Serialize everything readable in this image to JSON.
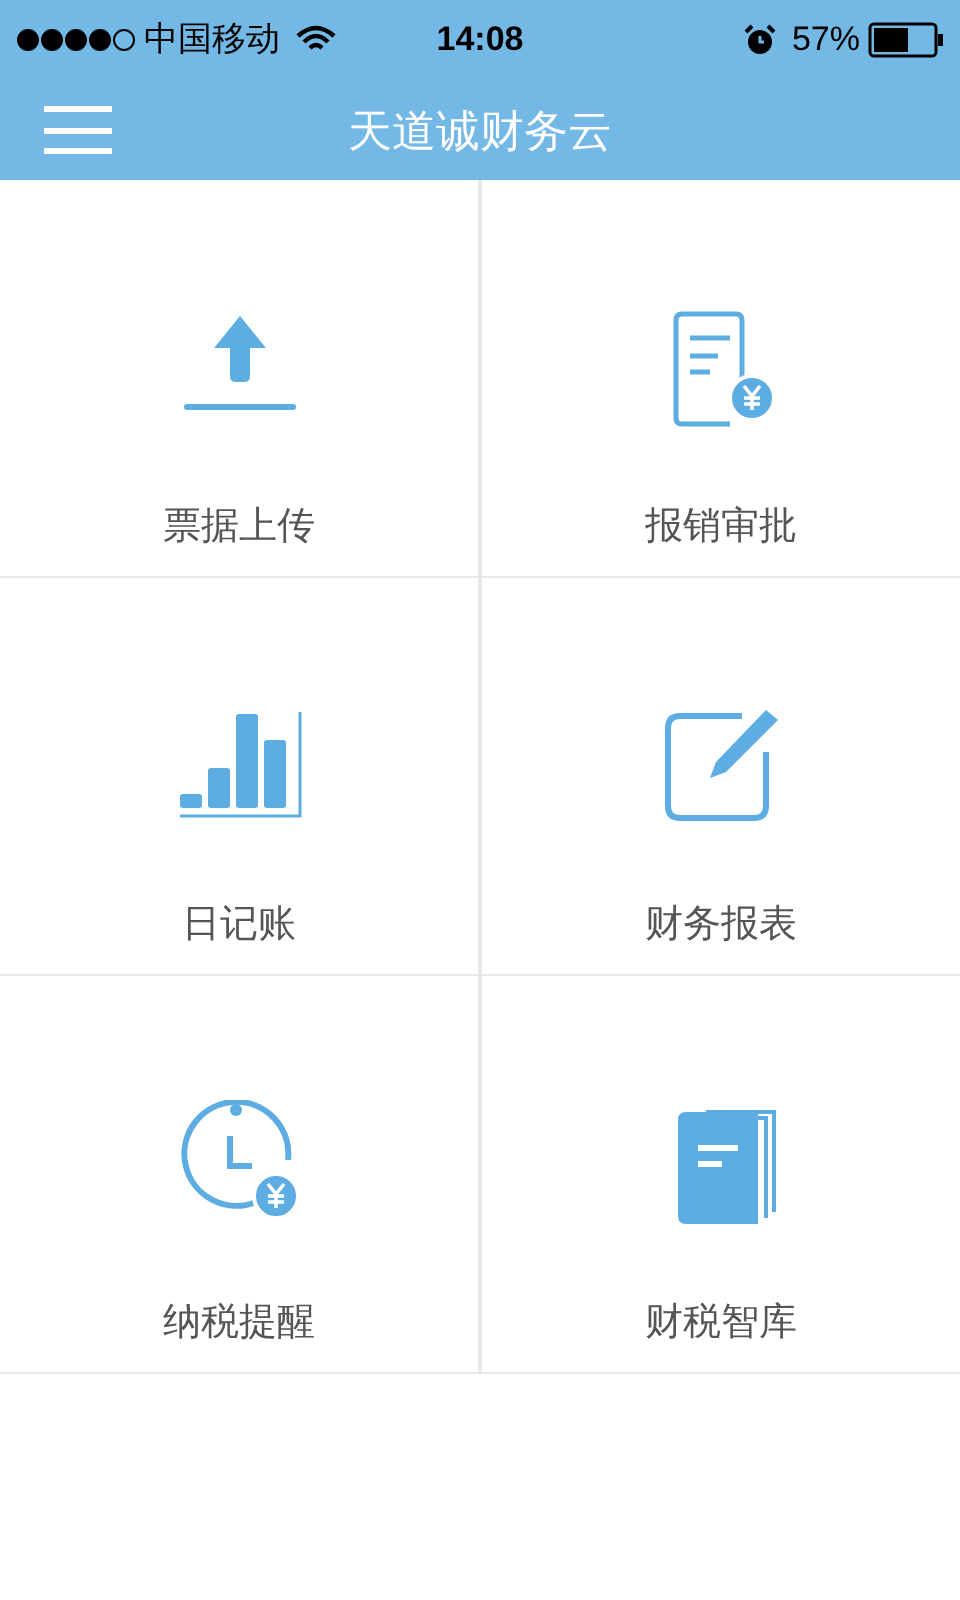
{
  "status_bar": {
    "carrier": "中国移动",
    "time": "14:08",
    "battery": "57%"
  },
  "header": {
    "title": "天道诚财务云"
  },
  "menu": [
    {
      "label": "票据上传",
      "kind": "upload"
    },
    {
      "label": "报销审批",
      "kind": "invoice"
    },
    {
      "label": "日记账",
      "kind": "chart"
    },
    {
      "label": "财务报表",
      "kind": "edit"
    },
    {
      "label": "纳税提醒",
      "kind": "clock"
    },
    {
      "label": "财税智库",
      "kind": "book"
    }
  ]
}
